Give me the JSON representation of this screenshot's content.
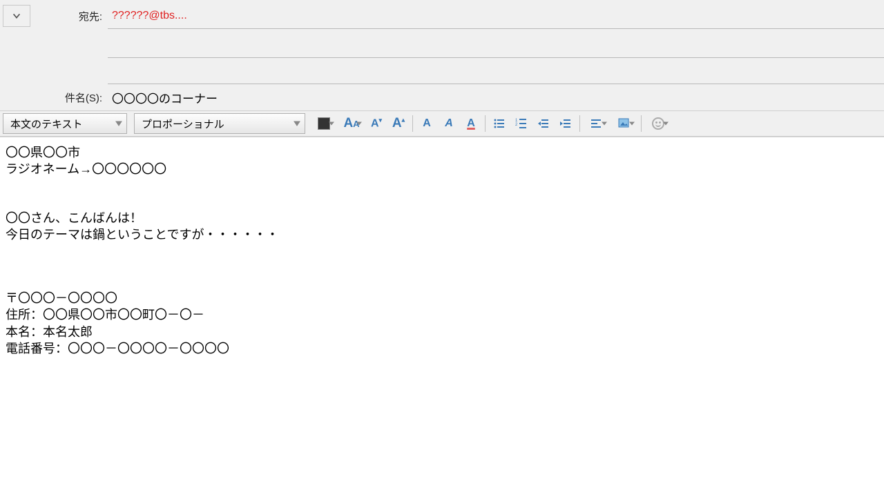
{
  "fields": {
    "to_label": "宛先:",
    "to_value": "??????@tbs....",
    "subject_label": "件名(S):",
    "subject_value": "〇〇〇〇のコーナー"
  },
  "toolbar": {
    "style_combo": "本文のテキスト",
    "font_combo": "プロポーショナル"
  },
  "body": {
    "line1": "〇〇県〇〇市",
    "line2": "ラジオネーム→〇〇〇〇〇〇",
    "line3": "〇〇さん、こんばんは！",
    "line4": "今日のテーマは鍋ということですが・・・・・・",
    "line5": "〒〇〇〇－〇〇〇〇",
    "line6": "住所：〇〇県〇〇市〇〇町〇－〇－",
    "line7": "本名：本名太郎",
    "line8": "電話番号：〇〇〇－〇〇〇〇－〇〇〇〇"
  }
}
